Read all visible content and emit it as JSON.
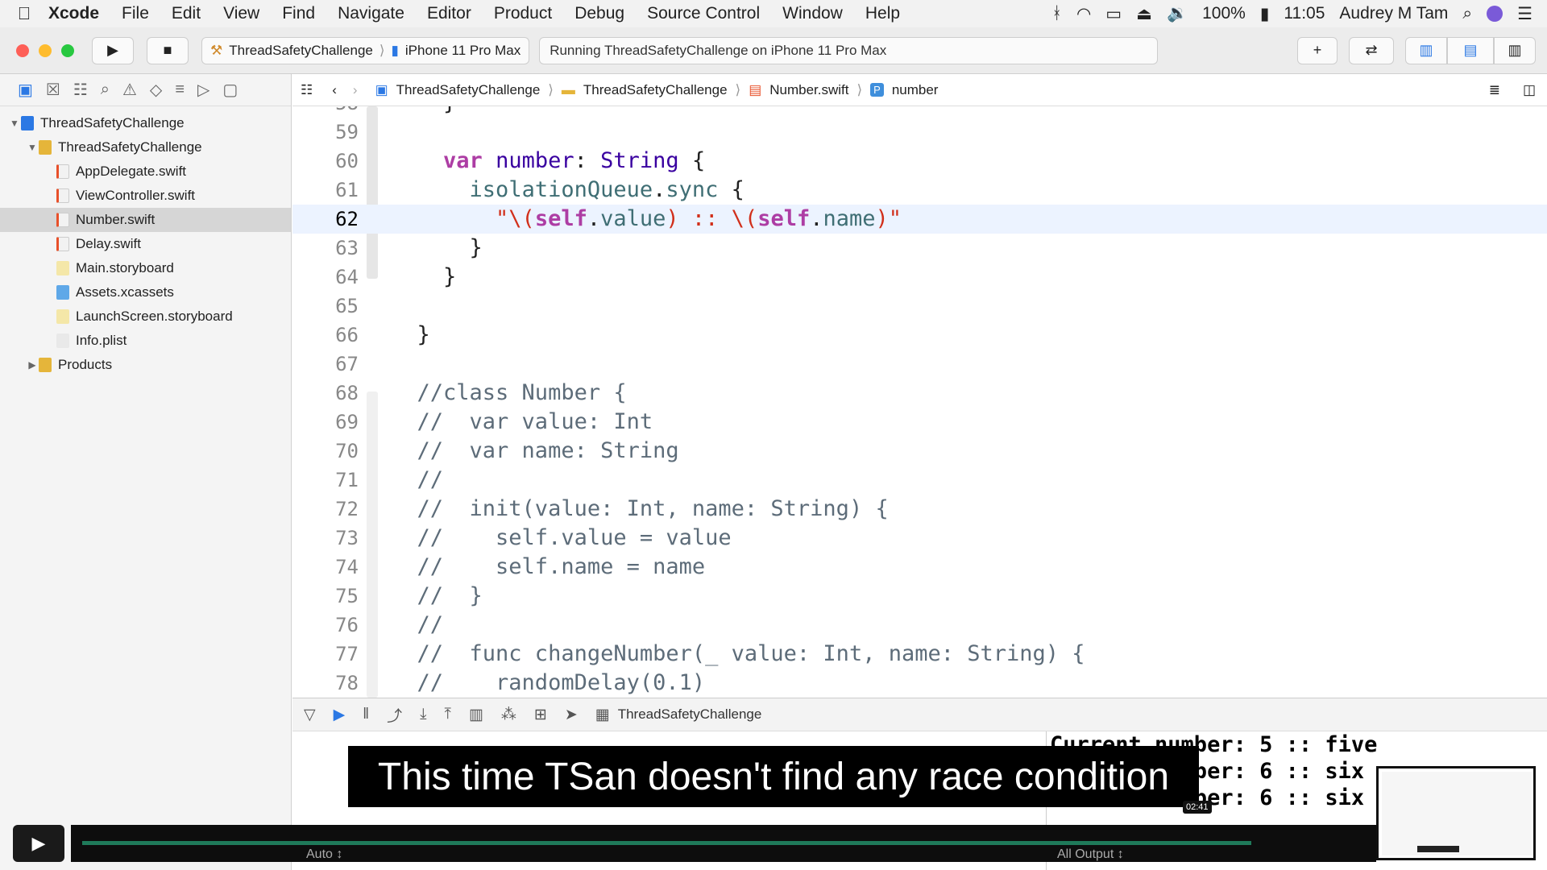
{
  "menubar": {
    "app": "Xcode",
    "items": [
      "File",
      "Edit",
      "View",
      "Find",
      "Navigate",
      "Editor",
      "Product",
      "Debug",
      "Source Control",
      "Window",
      "Help"
    ],
    "battery": "100%",
    "time": "11:05",
    "user": "Audrey M Tam"
  },
  "toolbar": {
    "scheme": "ThreadSafetyChallenge",
    "device": "iPhone 11 Pro Max",
    "status": "Running ThreadSafetyChallenge on iPhone 11 Pro Max"
  },
  "navigator": [
    {
      "label": "ThreadSafetyChallenge",
      "level": 0,
      "disclosure": "▼",
      "kind": "project"
    },
    {
      "label": "ThreadSafetyChallenge",
      "level": 1,
      "disclosure": "▼",
      "kind": "folder"
    },
    {
      "label": "AppDelegate.swift",
      "level": 2,
      "disclosure": "",
      "kind": "swift"
    },
    {
      "label": "ViewController.swift",
      "level": 2,
      "disclosure": "",
      "kind": "swift"
    },
    {
      "label": "Number.swift",
      "level": 2,
      "disclosure": "",
      "kind": "swift",
      "selected": true
    },
    {
      "label": "Delay.swift",
      "level": 2,
      "disclosure": "",
      "kind": "swift"
    },
    {
      "label": "Main.storyboard",
      "level": 2,
      "disclosure": "",
      "kind": "storyboard"
    },
    {
      "label": "Assets.xcassets",
      "level": 2,
      "disclosure": "",
      "kind": "assets"
    },
    {
      "label": "LaunchScreen.storyboard",
      "level": 2,
      "disclosure": "",
      "kind": "storyboard"
    },
    {
      "label": "Info.plist",
      "level": 2,
      "disclosure": "",
      "kind": "plist"
    },
    {
      "label": "Products",
      "level": 1,
      "disclosure": "▶",
      "kind": "folder"
    }
  ],
  "jumpbar": {
    "project": "ThreadSafetyChallenge",
    "group": "ThreadSafetyChallenge",
    "file": "Number.swift",
    "symbol": "number"
  },
  "code": [
    {
      "n": "58",
      "segs": [
        [
          "    }",
          "p"
        ]
      ]
    },
    {
      "n": "59",
      "segs": []
    },
    {
      "n": "60",
      "segs": [
        [
          "    ",
          "p"
        ],
        [
          "var",
          "kw"
        ],
        [
          " ",
          "p"
        ],
        [
          "number",
          "ty"
        ],
        [
          ": ",
          "p"
        ],
        [
          "String",
          "ty"
        ],
        [
          " {",
          "p"
        ]
      ]
    },
    {
      "n": "61",
      "segs": [
        [
          "      ",
          "p"
        ],
        [
          "isolationQueue",
          "pr"
        ],
        [
          ".",
          "p"
        ],
        [
          "sync",
          "pr"
        ],
        [
          " {",
          "p"
        ]
      ]
    },
    {
      "n": "62",
      "cur": true,
      "segs": [
        [
          "        ",
          "p"
        ],
        [
          "\"\\(",
          "st"
        ],
        [
          "self",
          "kw"
        ],
        [
          ".",
          "p"
        ],
        [
          "value",
          "pr"
        ],
        [
          ") :: \\(",
          "st"
        ],
        [
          "self",
          "kw"
        ],
        [
          ".",
          "p"
        ],
        [
          "name",
          "pr"
        ],
        [
          ")\"",
          "st"
        ]
      ]
    },
    {
      "n": "63",
      "segs": [
        [
          "      }",
          "p"
        ]
      ]
    },
    {
      "n": "64",
      "segs": [
        [
          "    }",
          "p"
        ]
      ]
    },
    {
      "n": "65",
      "segs": []
    },
    {
      "n": "66",
      "segs": [
        [
          "  }",
          "p"
        ]
      ]
    },
    {
      "n": "67",
      "segs": []
    },
    {
      "n": "68",
      "segs": [
        [
          "  //class Number {",
          "cm"
        ]
      ]
    },
    {
      "n": "69",
      "segs": [
        [
          "  //  var value: Int",
          "cm"
        ]
      ]
    },
    {
      "n": "70",
      "segs": [
        [
          "  //  var name: String",
          "cm"
        ]
      ]
    },
    {
      "n": "71",
      "segs": [
        [
          "  //",
          "cm"
        ]
      ]
    },
    {
      "n": "72",
      "segs": [
        [
          "  //  init(value: Int, name: String) {",
          "cm"
        ]
      ]
    },
    {
      "n": "73",
      "segs": [
        [
          "  //    self.value = value",
          "cm"
        ]
      ]
    },
    {
      "n": "74",
      "segs": [
        [
          "  //    self.name = name",
          "cm"
        ]
      ]
    },
    {
      "n": "75",
      "segs": [
        [
          "  //  }",
          "cm"
        ]
      ]
    },
    {
      "n": "76",
      "segs": [
        [
          "  //",
          "cm"
        ]
      ]
    },
    {
      "n": "77",
      "segs": [
        [
          "  //  func changeNumber(_ value: Int, name: String) {",
          "cm"
        ]
      ]
    },
    {
      "n": "78",
      "segs": [
        [
          "  //    randomDelay(0.1)",
          "cm"
        ]
      ]
    }
  ],
  "debugbar": {
    "target": "ThreadSafetyChallenge"
  },
  "console": [
    "Current number: 5 :: five",
    "Current number: 6 :: six",
    "Current number: 6 :: six"
  ],
  "subtitle": "This time TSan doesn't find any race condition",
  "video": {
    "time": "02:41",
    "progress": 0.93
  },
  "colors": {
    "accent": "#2b78e4",
    "keyword": "#ad3da4",
    "string": "#d12f1b",
    "comment": "#5d6c79"
  }
}
